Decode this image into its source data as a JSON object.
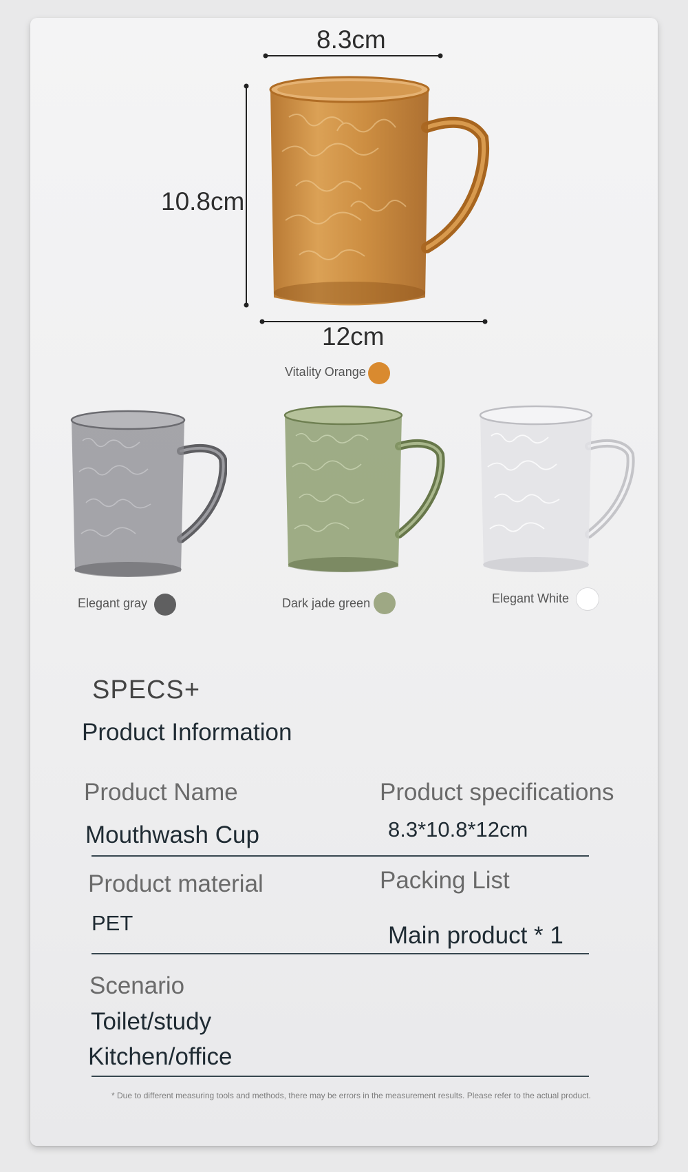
{
  "dimensions": {
    "width": "8.3cm",
    "height": "10.8cm",
    "depth": "12cm"
  },
  "colors": [
    {
      "name": "Vitality Orange",
      "hex": "#d98a2f"
    },
    {
      "name": "Elegant gray",
      "hex": "#5f5f60"
    },
    {
      "name": "Dark jade green",
      "hex": "#9ea884"
    },
    {
      "name": "Elegant White",
      "hex": "#ffffff"
    }
  ],
  "specs": {
    "heading": "SPECS+",
    "subheading": "Product Information",
    "product_name_label": "Product Name",
    "product_name_value": "Mouthwash Cup",
    "specifications_label": "Product specifications",
    "specifications_value": "8.3*10.8*12cm",
    "material_label": "Product material",
    "material_value": "PET",
    "packing_label": "Packing List",
    "packing_value": "Main product * 1",
    "scenario_label": "Scenario",
    "scenario_values": [
      "Toilet/study",
      "Kitchen/office"
    ]
  },
  "footnote": "* Due to different measuring tools and methods, there may be errors in the measurement results. Please refer to the actual product.",
  "mug_tints": {
    "orange": "#c7802f",
    "gray": "#7d7d80",
    "green": "#8a9b6a",
    "white": "#dcdcde"
  }
}
